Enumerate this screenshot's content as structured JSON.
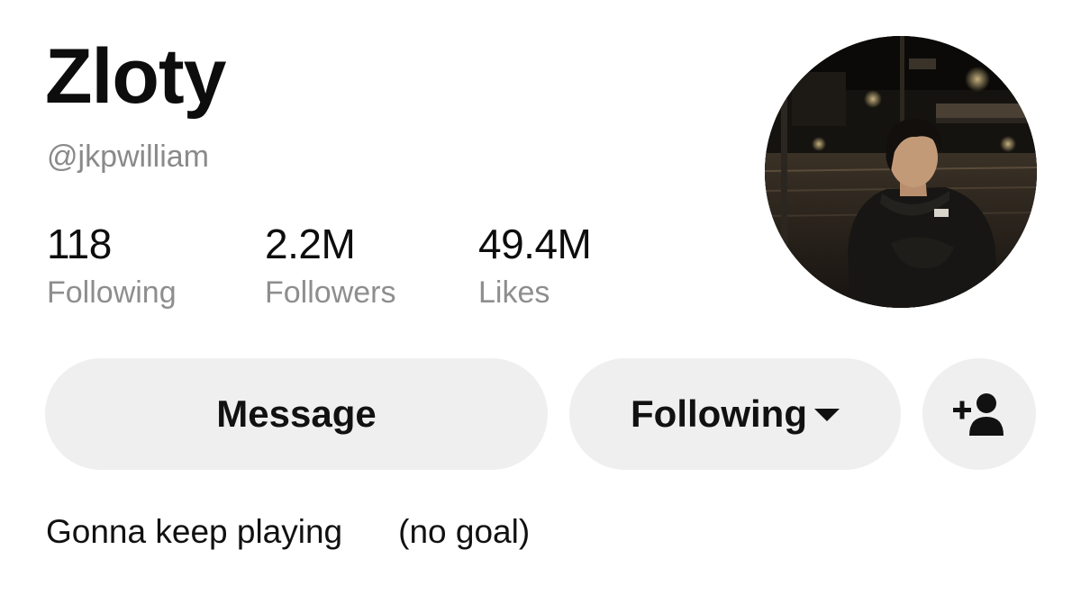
{
  "profile": {
    "display_name": "Zloty",
    "username": "@jkpwilliam",
    "avatar_icon": "profile-photo"
  },
  "stats": [
    {
      "value": "118",
      "label": "Following"
    },
    {
      "value": "2.2M",
      "label": "Followers"
    },
    {
      "value": "49.4M",
      "label": "Likes"
    }
  ],
  "actions": {
    "message_label": "Message",
    "following_label": "Following",
    "following_dropdown_icon": "caret-down-icon",
    "add_friend_icon": "add-user-icon"
  },
  "bio": {
    "part1": "Gonna keep playing",
    "part2": "(no goal)"
  },
  "colors": {
    "button_background": "#efefef",
    "secondary_text": "#8a8a8a",
    "primary_text": "#111111"
  }
}
